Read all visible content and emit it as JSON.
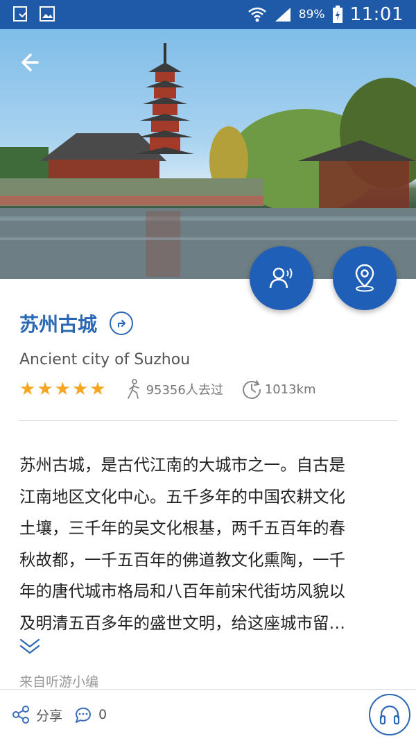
{
  "status_bar": {
    "battery": "89%",
    "time": "11:01"
  },
  "attraction": {
    "name": "苏州古城",
    "english_name": "Ancient city of Suzhou",
    "rating": 5,
    "stars": [
      "★",
      "★",
      "★",
      "★",
      "★"
    ],
    "visitors": "95356人去过",
    "distance": "1013km"
  },
  "description": {
    "lines": [
      "苏州古城，是古代江南的大城市之一。自古是",
      "江南地区文化中心。五千多年的中国农耕文化",
      "土壤，三千年的吴文化根基，两千五百年的春",
      "秋故都，一千五百年的佛道教文化熏陶，一千",
      "年的唐代城市格局和八百年前宋代街坊风貌以",
      "及明清五百多年的盛世文明，给这座城市留…"
    ],
    "source": "来自听游小编"
  },
  "bottom_bar": {
    "share_label": "分享",
    "comment_count": "0"
  },
  "colors": {
    "primary": "#1f5aa8",
    "title": "#2a67b5",
    "star": "#f5a623",
    "fab": "#1f5fb8"
  },
  "icons": [
    "back-arrow-icon",
    "audio-guide-icon",
    "location-pin-icon",
    "navigate-icon",
    "walking-person-icon",
    "distance-icon",
    "chevron-down-icon",
    "share-icon",
    "comment-icon",
    "headphones-icon"
  ]
}
